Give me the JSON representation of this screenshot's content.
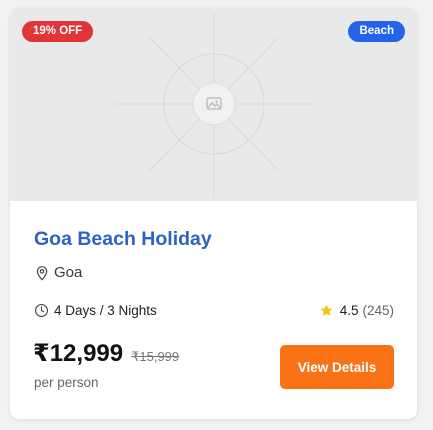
{
  "card": {
    "badges": {
      "discount": "19% OFF",
      "category": "Beach"
    },
    "image": {
      "icon": "image-placeholder-icon"
    },
    "title": "Goa Beach Holiday",
    "location": "Goa",
    "duration": "4 Days / 3 Nights",
    "rating": {
      "value": "4.5",
      "count": "(245)"
    },
    "price": {
      "current": "₹12,999",
      "original": "₹15,999",
      "unit": "per person"
    },
    "cta_label": "View Details"
  },
  "colors": {
    "title": "#2d63c8",
    "discount_badge": "#e0353b",
    "category_badge": "#2563eb",
    "cta": "#f97316",
    "star": "#f5c518"
  },
  "icons": {
    "location": "map-pin-icon",
    "duration": "clock-icon",
    "rating": "star-icon"
  }
}
